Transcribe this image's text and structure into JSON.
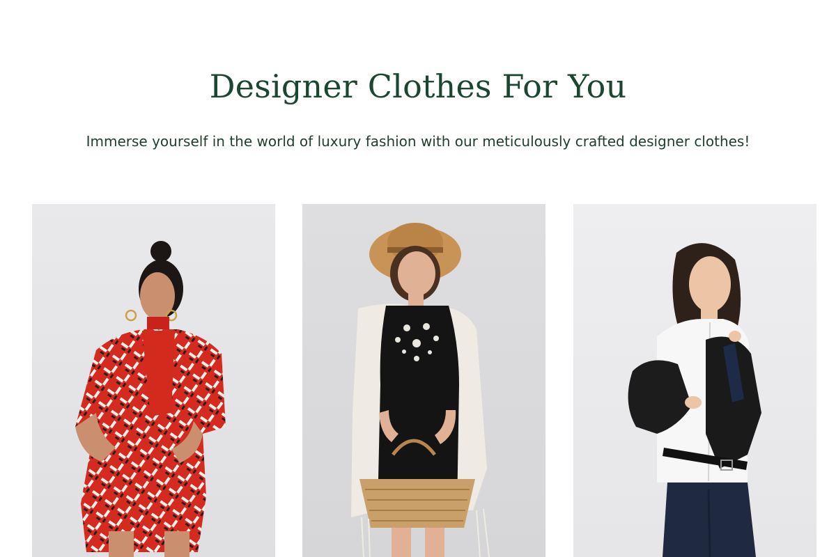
{
  "section": {
    "title": "Designer Clothes For You",
    "subtitle": "Immerse yourself in the world of luxury fashion with our meticulously crafted designer clothes!"
  },
  "products": [
    {
      "image_subject": "Woman wearing a red geometric-print shirt and shorts set with a red turtleneck",
      "background_color": "#e4e4e6",
      "accent_color": "#d42a1f"
    },
    {
      "image_subject": "Woman in a straw hat wearing a black embroidered dress and white cardigan holding a wicker bag",
      "background_color": "#dcdcde",
      "accent_color": "#111111"
    },
    {
      "image_subject": "Woman wearing a white shirt, black leather jacket and dark jeans",
      "background_color": "#ececee",
      "accent_color": "#1a1a1a"
    }
  ]
}
